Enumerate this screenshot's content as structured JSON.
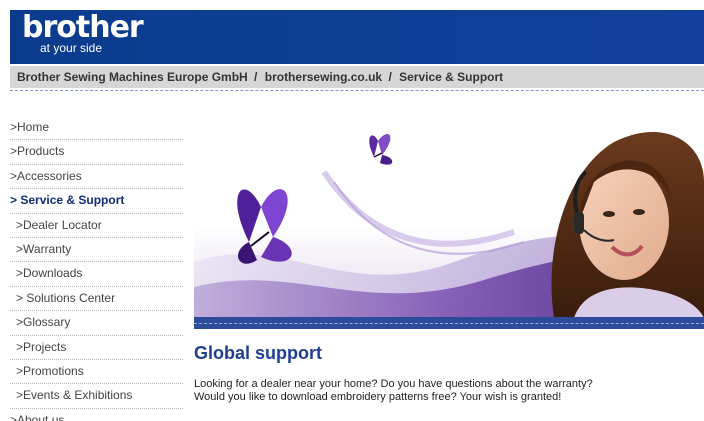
{
  "header": {
    "logo_word": "brother",
    "logo_tagline": "at your side",
    "brand_color": "#0d3f94"
  },
  "breadcrumb": {
    "items": [
      "Brother Sewing Machines Europe GmbH",
      "brothersewing.co.uk",
      "Service & Support"
    ],
    "separator": "/"
  },
  "sidebar": {
    "items": [
      {
        "label": ">Home"
      },
      {
        "label": ">Products"
      },
      {
        "label": ">Accessories"
      },
      {
        "label": "> Service & Support"
      },
      {
        "label": ">Dealer Locator"
      },
      {
        "label": ">Warranty"
      },
      {
        "label": ">Downloads"
      },
      {
        "label": "> Solutions Center"
      },
      {
        "label": ">Glossary"
      },
      {
        "label": ">Projects"
      },
      {
        "label": ">Promotions"
      },
      {
        "label": ">Events & Exhibitions"
      },
      {
        "label": ">About us"
      }
    ]
  },
  "main": {
    "banner_icon": "support-banner-image",
    "title": "Global support",
    "intro_lines": [
      "Looking for a dealer near your home? Do you have questions about the warranty?",
      "Would you like to download embroidery patterns free? Your wish is granted!"
    ]
  }
}
